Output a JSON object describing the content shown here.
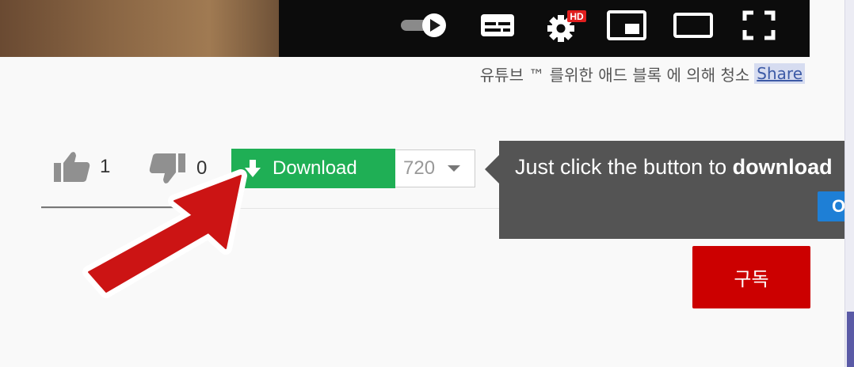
{
  "player": {
    "controls": [
      {
        "name": "autoplay-toggle"
      },
      {
        "name": "subtitles-button"
      },
      {
        "name": "settings-button",
        "badge": "HD"
      },
      {
        "name": "miniplayer-button"
      },
      {
        "name": "theater-mode-button"
      },
      {
        "name": "fullscreen-button"
      }
    ]
  },
  "ad_line": {
    "text": "유튜브 ™ 를위한 애드 블록 에 의해 청소",
    "share_label": "Share"
  },
  "actions": {
    "like_count": "1",
    "dislike_count": "0"
  },
  "download": {
    "label": "Download",
    "quality": "720"
  },
  "tooltip": {
    "text_prefix": "Just click the button to ",
    "text_bold": "download",
    "ok_label": "OK"
  },
  "subscribe": {
    "label": "구독"
  },
  "colors": {
    "download_green": "#1faf55",
    "subscribe_red": "#cc0000",
    "tooltip_bg": "#545454",
    "ok_blue": "#1e7fd6",
    "annotation_arrow": "#cc1414"
  },
  "icons": [
    "autoplay-toggle-icon",
    "subtitles-icon",
    "gear-icon",
    "miniplayer-icon",
    "theater-icon",
    "fullscreen-icon",
    "thumbs-up-icon",
    "thumbs-down-icon",
    "download-arrow-icon",
    "caret-down-icon",
    "annotation-arrow-icon"
  ]
}
